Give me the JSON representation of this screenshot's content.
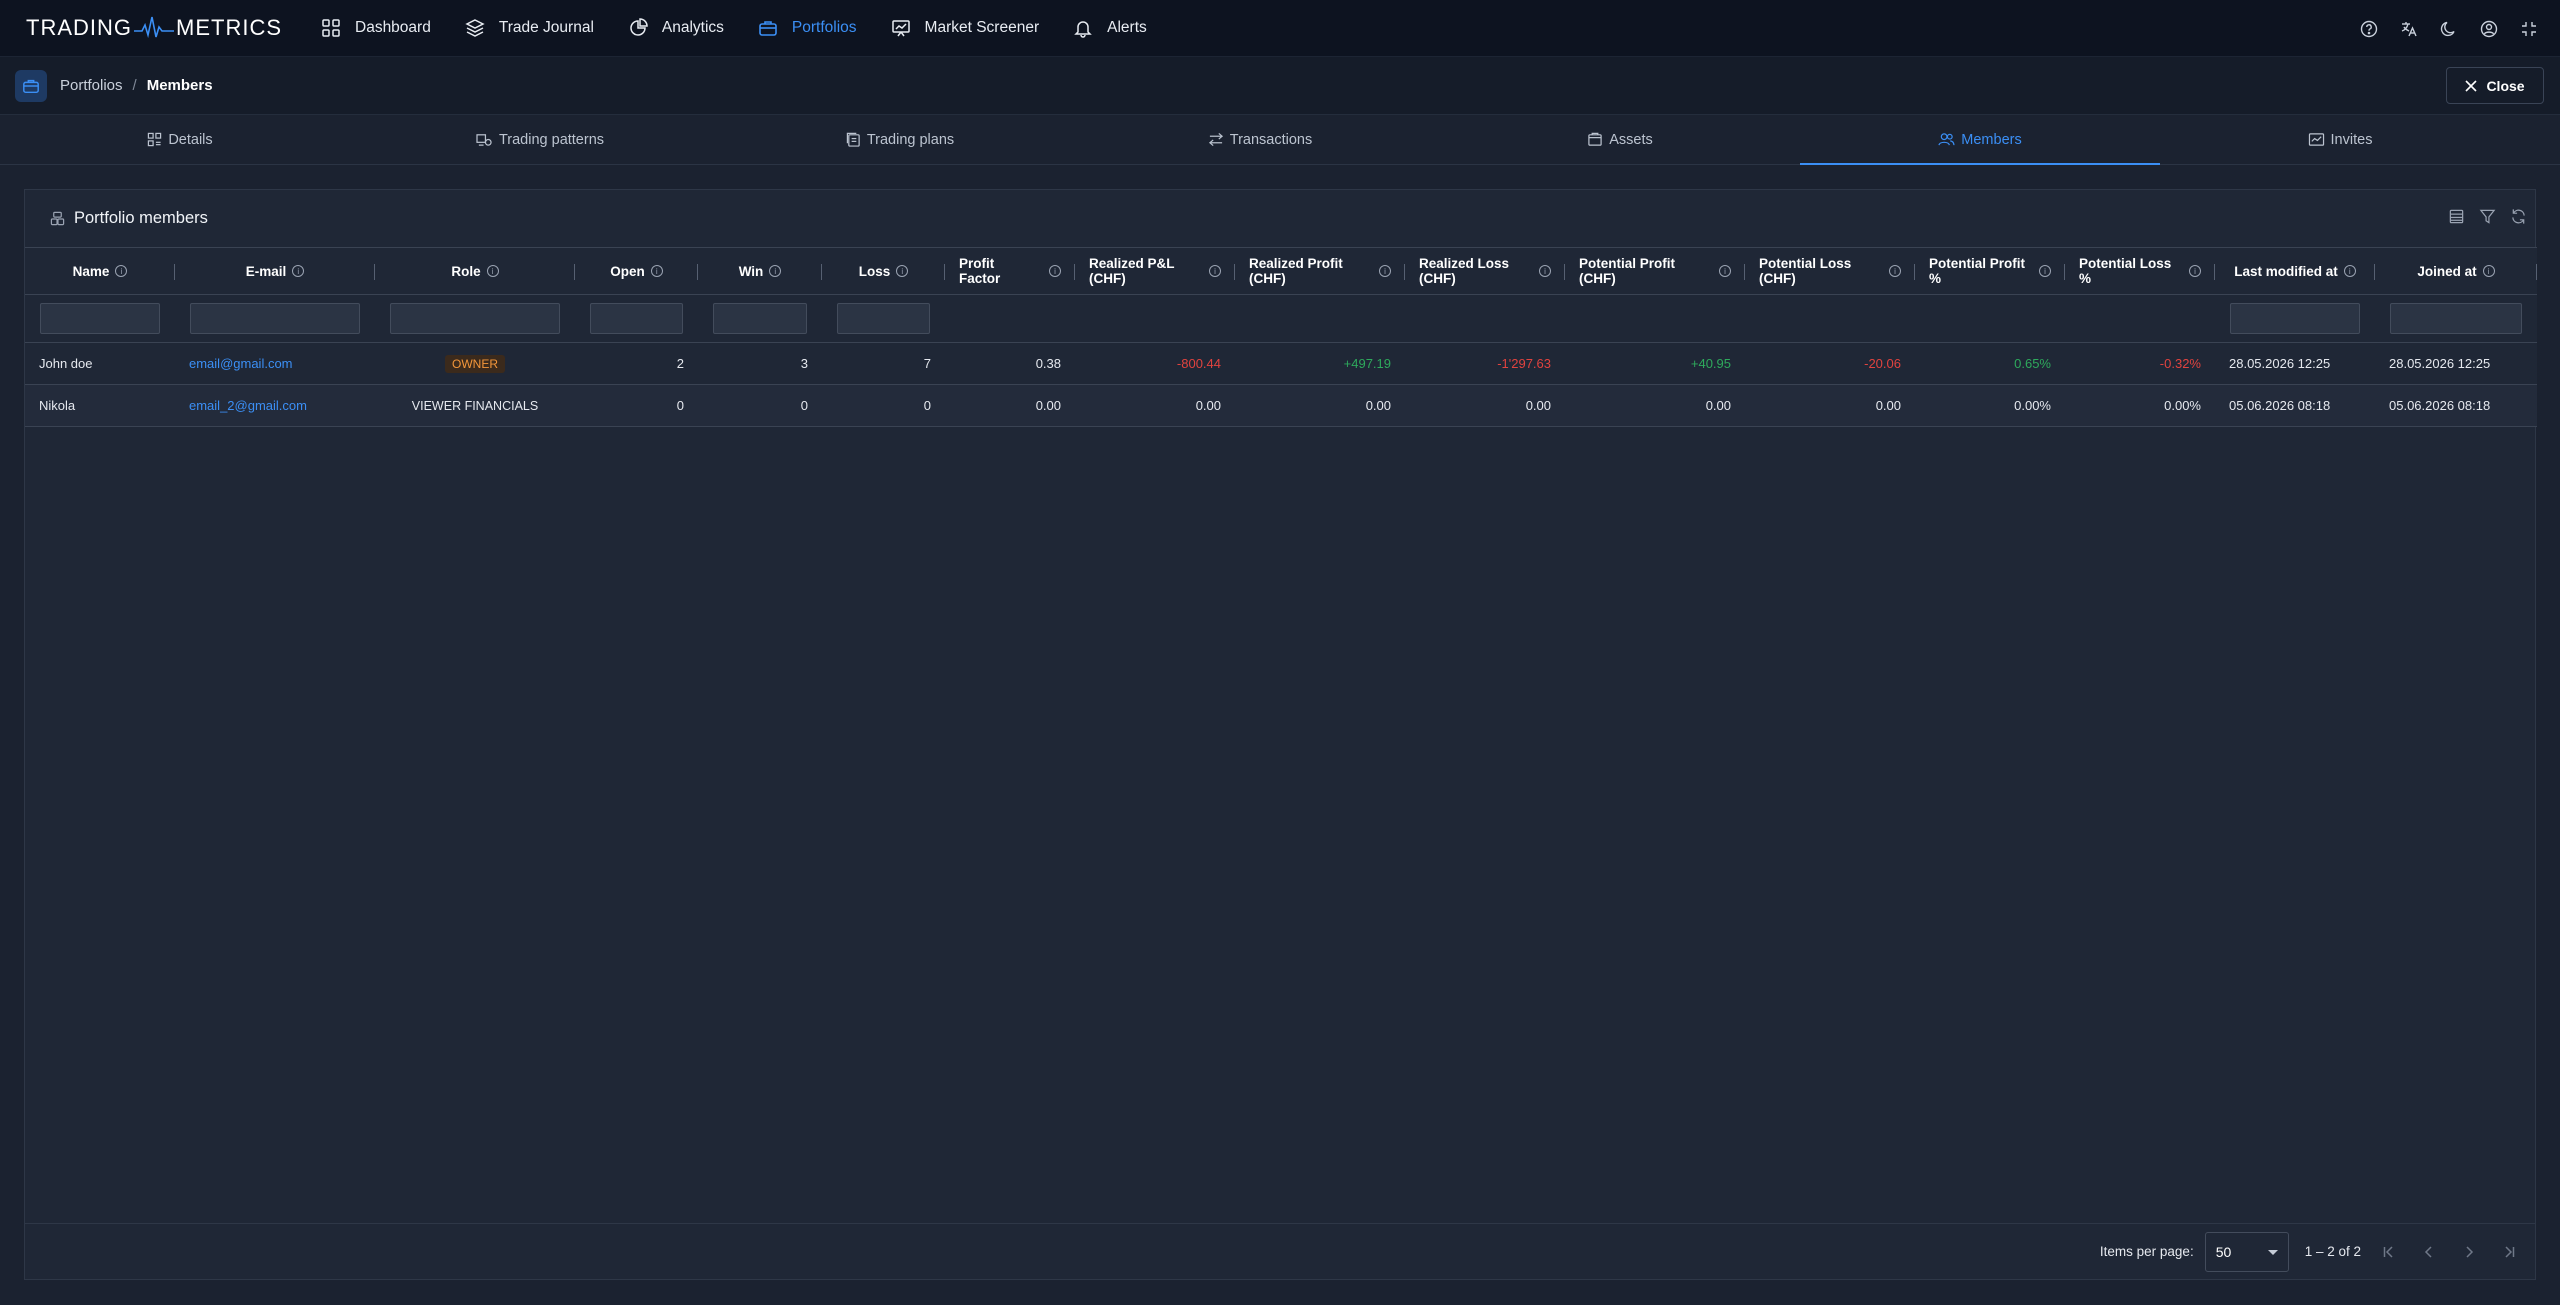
{
  "app": {
    "logo_left": "TRADING",
    "logo_right": "METRICS"
  },
  "nav": {
    "items": [
      {
        "label": "Dashboard",
        "icon": "grid-icon"
      },
      {
        "label": "Trade Journal",
        "icon": "layers-icon"
      },
      {
        "label": "Analytics",
        "icon": "pie-chart-icon"
      },
      {
        "label": "Portfolios",
        "icon": "briefcase-icon",
        "active": true
      },
      {
        "label": "Market Screener",
        "icon": "presentation-icon"
      },
      {
        "label": "Alerts",
        "icon": "bell-icon"
      }
    ],
    "actions": [
      "help-icon",
      "language-icon",
      "dark-mode-icon",
      "account-icon",
      "fullscreen-icon"
    ]
  },
  "breadcrumb": {
    "parent": "Portfolios",
    "separator": "/",
    "current": "Members"
  },
  "close_label": "Close",
  "tabs": [
    {
      "label": "Details",
      "icon": "details-icon"
    },
    {
      "label": "Trading patterns",
      "icon": "patterns-icon"
    },
    {
      "label": "Trading plans",
      "icon": "plans-icon"
    },
    {
      "label": "Transactions",
      "icon": "transfer-icon"
    },
    {
      "label": "Assets",
      "icon": "assets-icon"
    },
    {
      "label": "Members",
      "icon": "members-icon",
      "active": true
    },
    {
      "label": "Invites",
      "icon": "invites-icon"
    }
  ],
  "card": {
    "title": "Portfolio members"
  },
  "table": {
    "columns": [
      {
        "line1": "Name",
        "line2": ""
      },
      {
        "line1": "E-mail",
        "line2": ""
      },
      {
        "line1": "Role",
        "line2": ""
      },
      {
        "line1": "Open",
        "line2": ""
      },
      {
        "line1": "Win",
        "line2": ""
      },
      {
        "line1": "Loss",
        "line2": ""
      },
      {
        "line1": "Profit",
        "line2": "Factor"
      },
      {
        "line1": "Realized P&L",
        "line2": "(CHF)"
      },
      {
        "line1": "Realized Profit",
        "line2": "(CHF)"
      },
      {
        "line1": "Realized Loss",
        "line2": "(CHF)"
      },
      {
        "line1": "Potential Profit",
        "line2": "(CHF)"
      },
      {
        "line1": "Potential Loss",
        "line2": "(CHF)"
      },
      {
        "line1": "Potential Profit",
        "line2": "%"
      },
      {
        "line1": "Potential Loss",
        "line2": "%"
      },
      {
        "line1": "Last modified at",
        "line2": ""
      },
      {
        "line1": "Joined at",
        "line2": ""
      }
    ],
    "rows": [
      {
        "name": "John doe",
        "email": "email@gmail.com",
        "role": "OWNER",
        "open": "2",
        "win": "3",
        "loss": "7",
        "profit_factor": "0.38",
        "realized_pnl": "-800.44",
        "realized_profit": "+497.19",
        "realized_loss": "-1'297.63",
        "potential_profit": "+40.95",
        "potential_loss": "-20.06",
        "potential_profit_pct": "0.65%",
        "potential_loss_pct": "-0.32%",
        "last_modified": "28.05.2026 12:25",
        "joined": "28.05.2026 12:25"
      },
      {
        "name": "Nikola",
        "email": "email_2@gmail.com",
        "role": "VIEWER FINANCIALS",
        "open": "0",
        "win": "0",
        "loss": "0",
        "profit_factor": "0.00",
        "realized_pnl": "0.00",
        "realized_profit": "0.00",
        "realized_loss": "0.00",
        "potential_profit": "0.00",
        "potential_loss": "0.00",
        "potential_profit_pct": "0.00%",
        "potential_loss_pct": "0.00%",
        "last_modified": "05.06.2026 08:18",
        "joined": "05.06.2026 08:18"
      }
    ]
  },
  "footer": {
    "items_per_page_label": "Items per page:",
    "items_per_page_value": "50",
    "range_label": "1 – 2 of 2"
  },
  "colors": {
    "accent": "#3b8ff5",
    "positive": "#2ea95c",
    "negative": "#e0433f",
    "badge_owner": "#f3963a"
  }
}
